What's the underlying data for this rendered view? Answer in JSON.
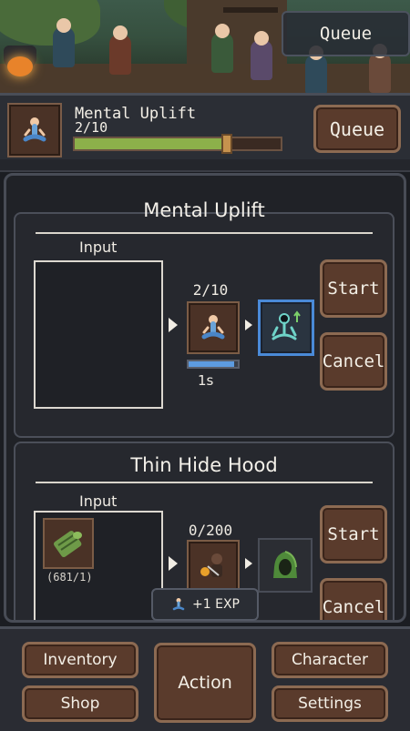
{
  "scene": {
    "queue_label": "Queue"
  },
  "header": {
    "task_name": "Mental Uplift",
    "task_count": "2/10",
    "progress_fraction": 0.74,
    "queue_label": "Queue"
  },
  "recipes": [
    {
      "title": "Mental Uplift",
      "input_label": "Input",
      "count": "2/10",
      "time": "1s",
      "progress_fraction": 0.93,
      "start_label": "Start",
      "cancel_label": "Cancel"
    },
    {
      "title": "Thin Hide Hood",
      "input_label": "Input",
      "count": "0/200",
      "material_count": "(681/1)",
      "start_label": "Start",
      "cancel_label": "Cancel"
    }
  ],
  "toast": {
    "text": "+1 EXP"
  },
  "nav": {
    "inventory": "Inventory",
    "shop": "Shop",
    "action": "Action",
    "character": "Character",
    "settings": "Settings"
  },
  "colors": {
    "progress_green": "#8cb04a",
    "accent_blue": "#4a8ad8",
    "button_brown": "#5a3b2c"
  },
  "icons": [
    "meditating-person-icon",
    "meditation-aura-icon",
    "leather-roll-icon",
    "crafter-icon",
    "green-hood-icon"
  ]
}
